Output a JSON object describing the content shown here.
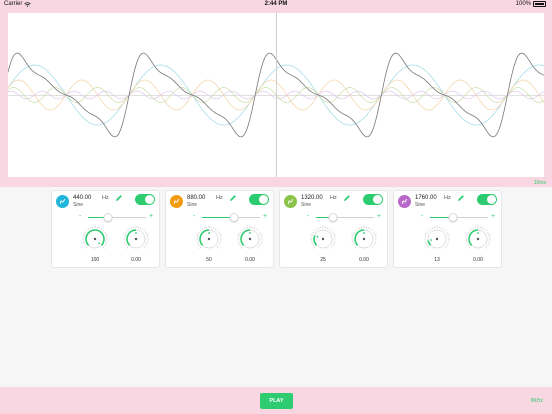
{
  "status": {
    "carrier": "Carrier",
    "time": "2:44 PM",
    "battery": "100%"
  },
  "scope": {
    "time_label": "10ms"
  },
  "colors": {
    "accent": "#2ecc71",
    "pink": "#f9d7e2"
  },
  "oscillators": [
    {
      "frequency": "440.00",
      "unit": "Hz",
      "waveform": "Sine",
      "enabled": true,
      "slider": 0.35,
      "knob1_value": "100",
      "knob2_value": "0.00",
      "icon_color": "#1fb6d9",
      "knob1_level": 1.0
    },
    {
      "frequency": "880.00",
      "unit": "Hz",
      "waveform": "Sine",
      "enabled": true,
      "slider": 0.55,
      "knob1_value": "50",
      "knob2_value": "0.00",
      "icon_color": "#f39c12",
      "knob1_level": 0.5
    },
    {
      "frequency": "1320.00",
      "unit": "Hz",
      "waveform": "Sine",
      "enabled": true,
      "slider": 0.3,
      "knob1_value": "25",
      "knob2_value": "0.00",
      "icon_color": "#8bc34a",
      "knob1_level": 0.25
    },
    {
      "frequency": "1760.00",
      "unit": "Hz",
      "waveform": "Sine",
      "enabled": true,
      "slider": 0.4,
      "knob1_value": "13",
      "knob2_value": "0.00",
      "icon_color": "#b868c8",
      "knob1_level": 0.13
    }
  ],
  "controls": {
    "minus": "-",
    "plus": "+"
  },
  "bottom": {
    "play_label": "PLAY",
    "sample_rate": "8KHz"
  }
}
